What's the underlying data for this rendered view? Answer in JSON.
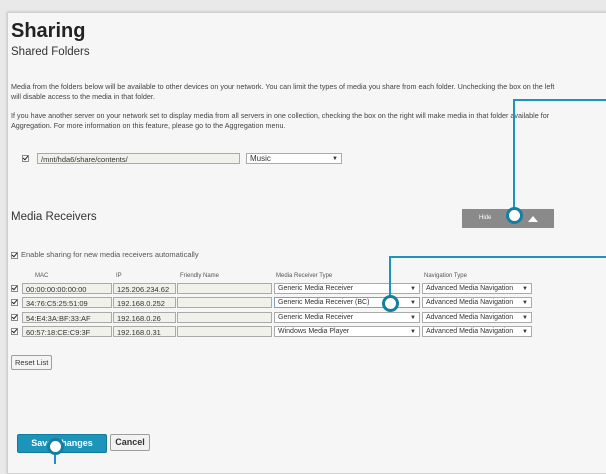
{
  "header": {
    "title": "Sharing",
    "subtitle": "Shared Folders"
  },
  "intro": {
    "p1": "Media from the folders below will be available to other devices on your network. You can limit the types of media you share from each folder. Unchecking the box on the left will disable access to the media in that folder.",
    "p2": "If you have another server on your network set to display media from all servers in one collection, checking the box on the right will make media in that folder available for Aggregation. For more information on this feature, please go to the Aggregation menu."
  },
  "folder": {
    "path": "/mnt/hda6/share/contents/",
    "media_type": "Music"
  },
  "receivers": {
    "title": "Media Receivers",
    "hide_label": "Hide",
    "enable_auto": "Enable sharing for new media receivers automatically",
    "headers": {
      "mac": "MAC",
      "ip": "IP",
      "friendly": "Friendly Name",
      "type": "Media Receiver Type",
      "nav": "Navigation Type"
    },
    "rows": [
      {
        "mac": "00:00:00:00:00:00",
        "ip": "125.206.234.62",
        "friendly": "",
        "type": "Generic Media Receiver",
        "nav": "Advanced Media Navigation"
      },
      {
        "mac": "34:76:C5:25:51:09",
        "ip": "192.168.0.252",
        "friendly": "",
        "type": "Generic Media Receiver (BC)",
        "nav": "Advanced Media Navigation"
      },
      {
        "mac": "54:E4:3A:BF:33:AF",
        "ip": "192.168.0.26",
        "friendly": "",
        "type": "Generic Media Receiver",
        "nav": "Advanced Media Navigation"
      },
      {
        "mac": "60:57:18:CE:C9:3F",
        "ip": "192.168.0.31",
        "friendly": "",
        "type": "Windows Media Player",
        "nav": "Advanced Media Navigation"
      }
    ],
    "reset_label": "Reset List"
  },
  "footer": {
    "save_label": "Save Changes",
    "cancel_label": "Cancel"
  },
  "colors": {
    "accent": "#1d94ba",
    "hide_button": "#8a8a8a",
    "background": "#f6f6f6"
  },
  "icons": {
    "dropdown": "chevron-down-icon",
    "collapse": "triangle-up-icon",
    "callout": "callout-dot-icon"
  }
}
